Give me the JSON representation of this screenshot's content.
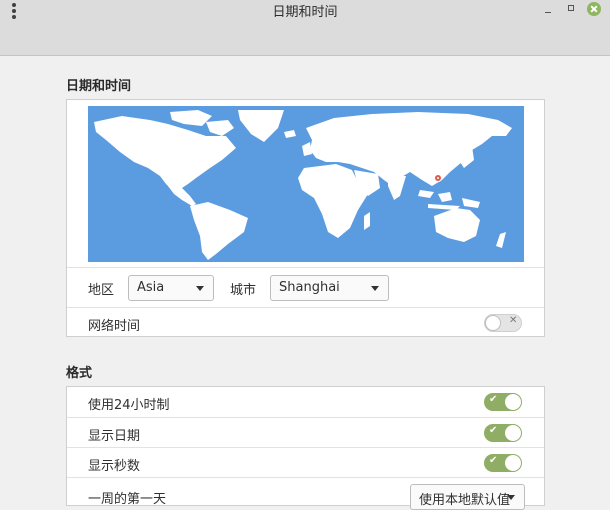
{
  "window": {
    "title": "日期和时间"
  },
  "datetime_section": {
    "heading": "日期和时间",
    "region_label": "地区",
    "region_value": "Asia",
    "city_label": "城市",
    "city_value": "Shanghai",
    "network_time_label": "网络时间",
    "network_time_enabled": false
  },
  "format_section": {
    "heading": "格式",
    "rows": [
      {
        "label": "使用24小时制",
        "enabled": true
      },
      {
        "label": "显示日期",
        "enabled": true
      },
      {
        "label": "显示秒数",
        "enabled": true
      }
    ],
    "first_day_label": "一周的第一天",
    "first_day_value": "使用本地默认值"
  },
  "icons": {
    "enabled_mark": "✔",
    "disabled_mark": "✕"
  },
  "colors": {
    "map_water": "#5b9bdf",
    "map_land": "#ffffff",
    "switch_on": "#8fad64",
    "close_button": "#8eb660"
  }
}
